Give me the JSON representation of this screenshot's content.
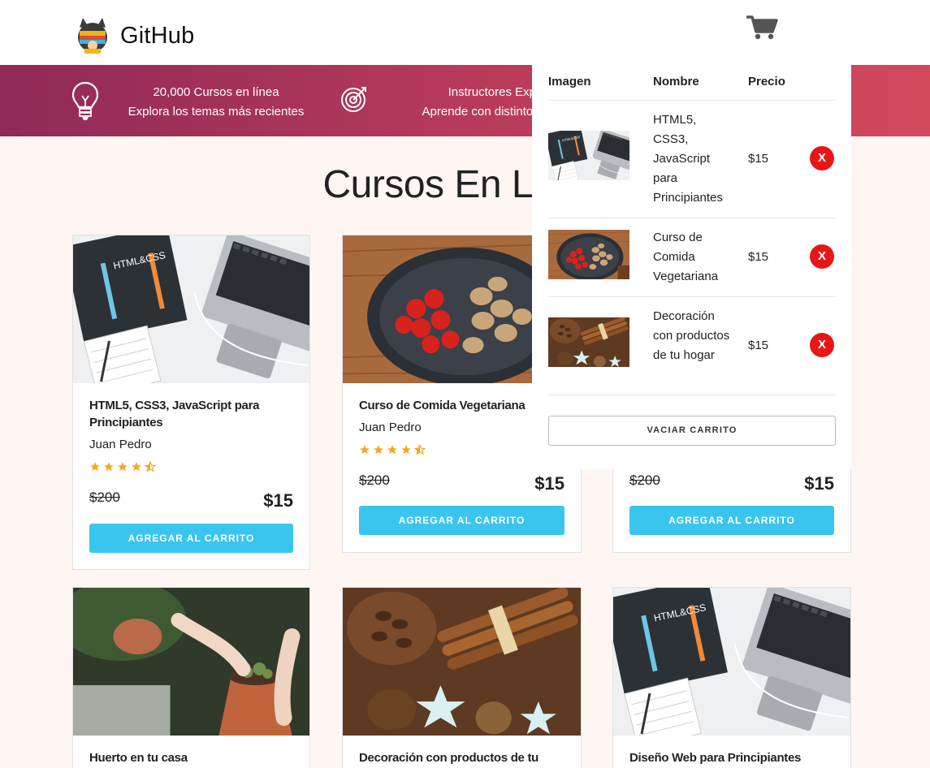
{
  "header": {
    "brand": "GitHub",
    "logo_icon": "github-octocat-logo",
    "cart_icon": "shopping-cart-icon"
  },
  "promo": {
    "items": [
      {
        "line1": "20,000 Cursos en línea",
        "line2": "Explora los temas más recientes",
        "icon": "lightbulb-icon"
      },
      {
        "line1": "Instructores Expertos",
        "line2": "Aprende con distintos expertos",
        "icon": "target-icon"
      }
    ]
  },
  "main": {
    "title": "Cursos En Línea"
  },
  "courses": [
    {
      "title": "HTML5, CSS3, JavaScript para Principiantes",
      "author": "Juan Pedro",
      "rating": 4.5,
      "old_price": "$200",
      "price": "$15",
      "button": "AGREGAR AL CARRITO",
      "image": "laptop-html-book"
    },
    {
      "title": "Curso de Comida Vegetariana",
      "author": "Juan Pedro",
      "rating": 4.5,
      "old_price": "$200",
      "price": "$15",
      "button": "AGREGAR AL CARRITO",
      "image": "vegetables-pan"
    },
    {
      "old_price": "$200",
      "price": "$15",
      "button": "AGREGAR AL CARRITO",
      "image": "hidden"
    },
    {
      "title": "Huerto en tu casa",
      "image": "plant-pot"
    },
    {
      "title": "Decoración con productos de tu",
      "image": "cinnamon-pinecones"
    },
    {
      "title": "Diseño Web para Principiantes",
      "image": "laptop-html-book"
    }
  ],
  "cart": {
    "headers": {
      "image": "Imagen",
      "name": "Nombre",
      "price": "Precio"
    },
    "items": [
      {
        "name": "HTML5, CSS3, JavaScript para Principiantes",
        "price": "$15",
        "remove": "X",
        "image": "laptop-html-book"
      },
      {
        "name": "Curso de Comida Vegetariana",
        "price": "$15",
        "remove": "X",
        "image": "vegetables-pan"
      },
      {
        "name": "Decoración con productos de tu hogar",
        "price": "$15",
        "remove": "X",
        "image": "cinnamon-pinecones"
      }
    ],
    "empty_button": "VACIAR CARRITO"
  },
  "colors": {
    "accent": "#3ac5ef",
    "promo_start": "#8f2a57",
    "promo_end": "#d1495b",
    "remove": "#e81616",
    "star": "#f5a623"
  }
}
